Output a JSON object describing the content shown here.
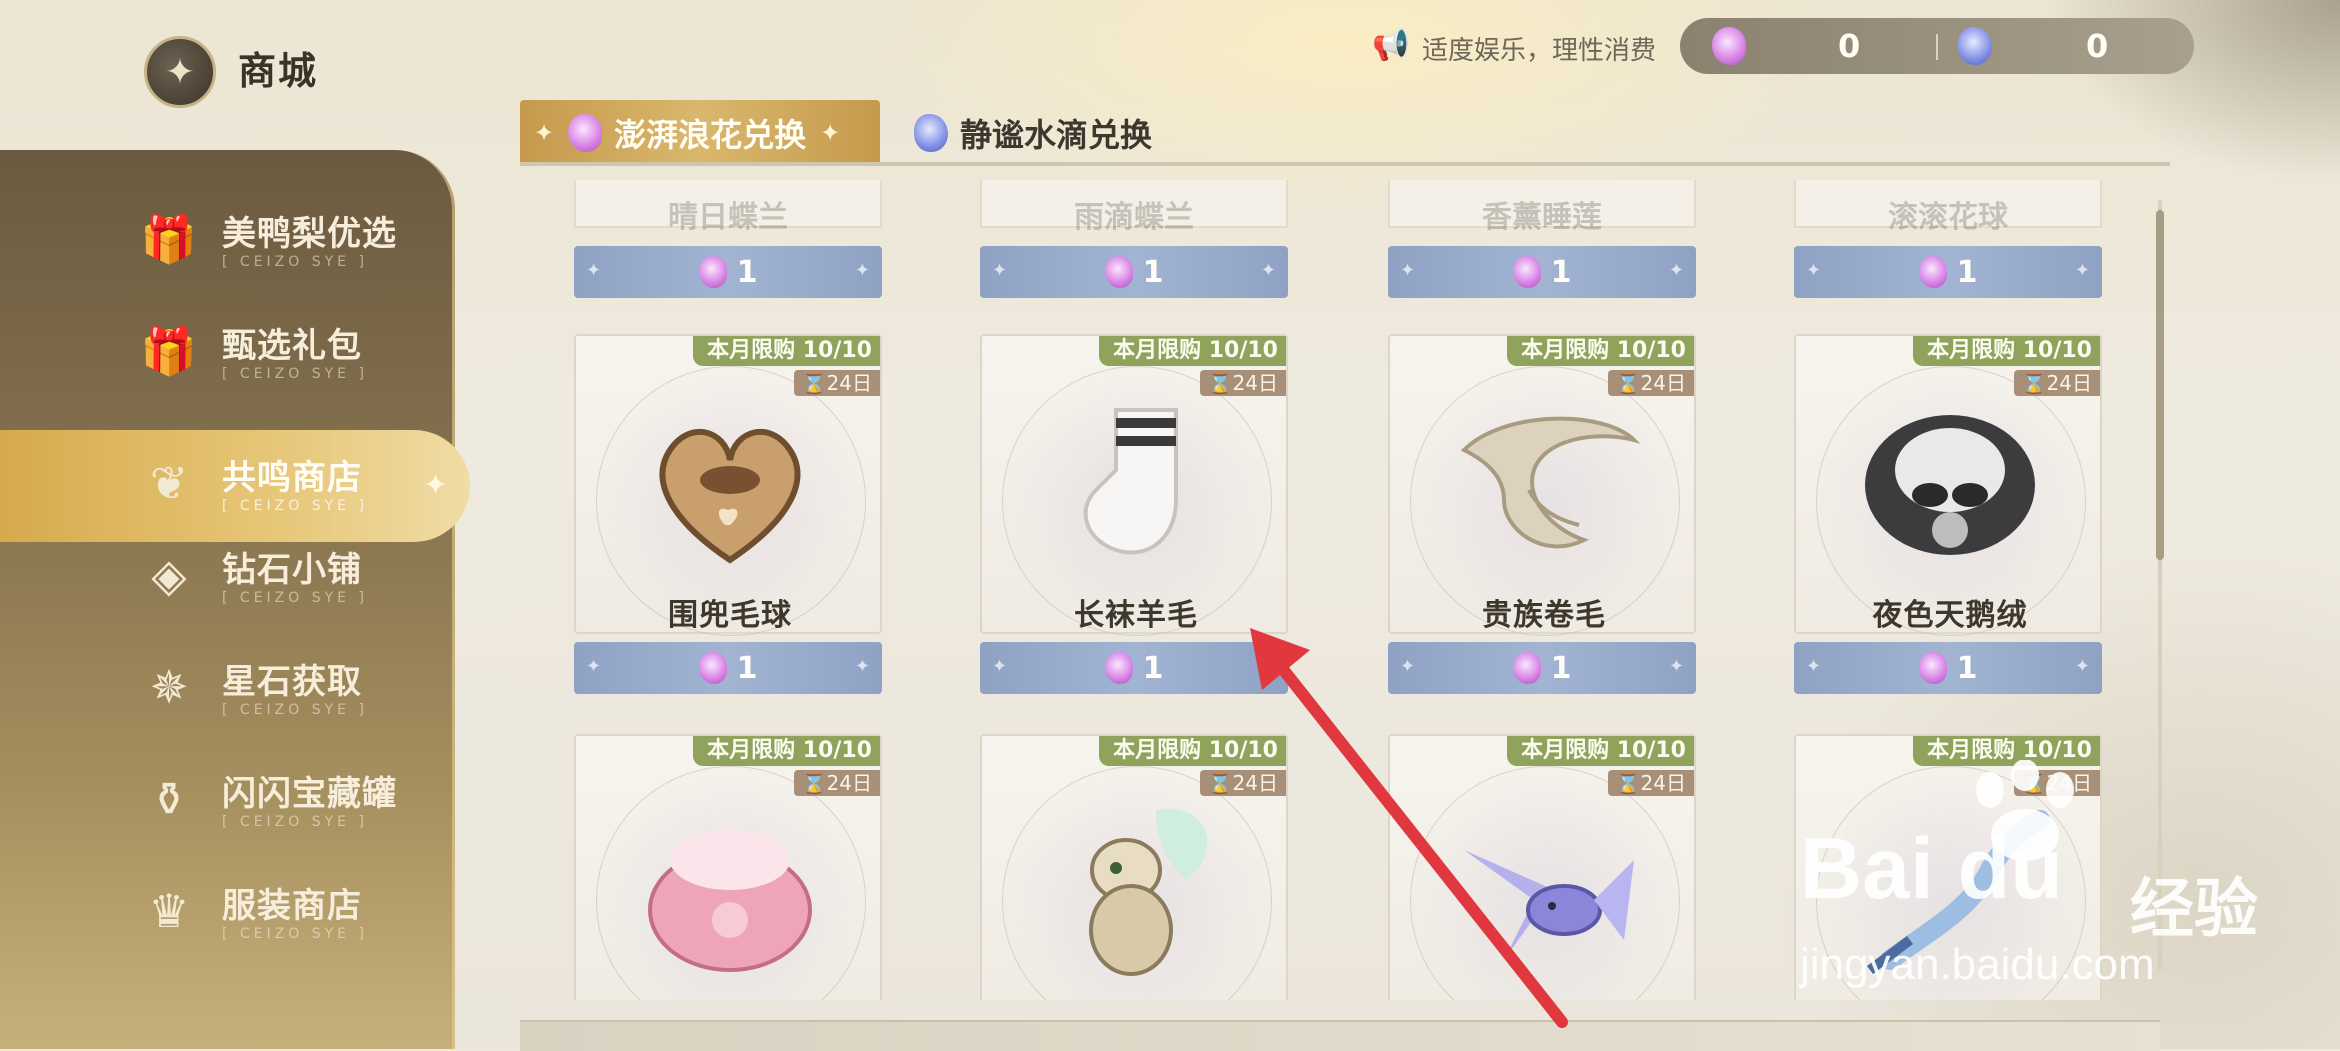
{
  "app": {
    "title": "商城"
  },
  "notice": "适度娱乐，理性消费",
  "currency": [
    {
      "name": "pink-gem",
      "value": "0",
      "color": "#d67fe4"
    },
    {
      "name": "blue-gem",
      "value": "0",
      "color": "#7f8de4"
    }
  ],
  "sidebar": {
    "items": [
      {
        "label": "美鸭梨优选",
        "sub": "[ CEIZO SYE ]",
        "icon": "gift-box-icon",
        "active": false
      },
      {
        "label": "甄选礼包",
        "sub": "[ CEIZO SYE ]",
        "icon": "gift-icon",
        "active": false
      },
      {
        "label": "共鸣商店",
        "sub": "[ CEIZO SYE ]",
        "icon": "flame-icon",
        "active": true
      },
      {
        "label": "钻石小铺",
        "sub": "[ CEIZO SYE ]",
        "icon": "diamond-icon",
        "active": false
      },
      {
        "label": "星石获取",
        "sub": "[ CEIZO SYE ]",
        "icon": "star-stone-icon",
        "active": false
      },
      {
        "label": "闪闪宝藏罐",
        "sub": "[ CEIZO SYE ]",
        "icon": "treasure-jar-icon",
        "active": false
      },
      {
        "label": "服装商店",
        "sub": "[ CEIZO SYE ]",
        "icon": "clothing-icon",
        "active": false
      }
    ]
  },
  "tabs": [
    {
      "label": "澎湃浪花兑换",
      "active": true
    },
    {
      "label": "静谧水滴兑换",
      "active": false
    }
  ],
  "grid": {
    "faded_row": [
      {
        "name": "晴日蝶兰",
        "price": "1"
      },
      {
        "name": "雨滴蝶兰",
        "price": "1"
      },
      {
        "name": "香薰睡莲",
        "price": "1"
      },
      {
        "name": "滚滚花球",
        "price": "1"
      }
    ],
    "row1": [
      {
        "name": "围兜毛球",
        "limit": "本月限购 10/10",
        "days": "24日",
        "price": "1"
      },
      {
        "name": "长袜羊毛",
        "limit": "本月限购 10/10",
        "days": "24日",
        "price": "1"
      },
      {
        "name": "贵族卷毛",
        "limit": "本月限购 10/10",
        "days": "24日",
        "price": "1"
      },
      {
        "name": "夜色天鹅绒",
        "limit": "本月限购 10/10",
        "days": "24日",
        "price": "1"
      }
    ],
    "row2": [
      {
        "limit": "本月限购 10/10",
        "days": "24日"
      },
      {
        "limit": "本月限购 10/10",
        "days": "24日"
      },
      {
        "limit": "本月限购 10/10",
        "days": "24日"
      },
      {
        "limit": "本月限购 10/10",
        "days": "24日"
      }
    ]
  },
  "watermark": {
    "brand": "Bai du",
    "cn": "经验",
    "url": "jingyan.baidu.com"
  },
  "colors": {
    "accent_gold": "#d6aa4c",
    "limit_green": "#8fa35c",
    "price_blue": "#a2b4d2",
    "arrow_red": "#e0383e"
  }
}
